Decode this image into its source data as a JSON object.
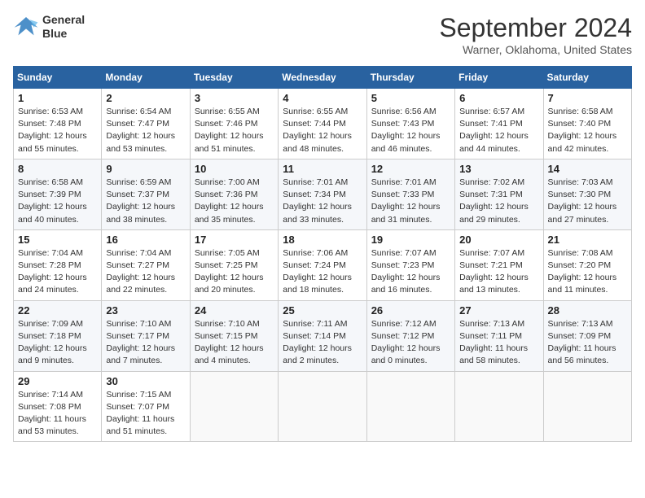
{
  "logo": {
    "line1": "General",
    "line2": "Blue"
  },
  "title": "September 2024",
  "location": "Warner, Oklahoma, United States",
  "days_header": [
    "Sunday",
    "Monday",
    "Tuesday",
    "Wednesday",
    "Thursday",
    "Friday",
    "Saturday"
  ],
  "weeks": [
    [
      {
        "day": "1",
        "info": "Sunrise: 6:53 AM\nSunset: 7:48 PM\nDaylight: 12 hours\nand 55 minutes."
      },
      {
        "day": "2",
        "info": "Sunrise: 6:54 AM\nSunset: 7:47 PM\nDaylight: 12 hours\nand 53 minutes."
      },
      {
        "day": "3",
        "info": "Sunrise: 6:55 AM\nSunset: 7:46 PM\nDaylight: 12 hours\nand 51 minutes."
      },
      {
        "day": "4",
        "info": "Sunrise: 6:55 AM\nSunset: 7:44 PM\nDaylight: 12 hours\nand 48 minutes."
      },
      {
        "day": "5",
        "info": "Sunrise: 6:56 AM\nSunset: 7:43 PM\nDaylight: 12 hours\nand 46 minutes."
      },
      {
        "day": "6",
        "info": "Sunrise: 6:57 AM\nSunset: 7:41 PM\nDaylight: 12 hours\nand 44 minutes."
      },
      {
        "day": "7",
        "info": "Sunrise: 6:58 AM\nSunset: 7:40 PM\nDaylight: 12 hours\nand 42 minutes."
      }
    ],
    [
      {
        "day": "8",
        "info": "Sunrise: 6:58 AM\nSunset: 7:39 PM\nDaylight: 12 hours\nand 40 minutes."
      },
      {
        "day": "9",
        "info": "Sunrise: 6:59 AM\nSunset: 7:37 PM\nDaylight: 12 hours\nand 38 minutes."
      },
      {
        "day": "10",
        "info": "Sunrise: 7:00 AM\nSunset: 7:36 PM\nDaylight: 12 hours\nand 35 minutes."
      },
      {
        "day": "11",
        "info": "Sunrise: 7:01 AM\nSunset: 7:34 PM\nDaylight: 12 hours\nand 33 minutes."
      },
      {
        "day": "12",
        "info": "Sunrise: 7:01 AM\nSunset: 7:33 PM\nDaylight: 12 hours\nand 31 minutes."
      },
      {
        "day": "13",
        "info": "Sunrise: 7:02 AM\nSunset: 7:31 PM\nDaylight: 12 hours\nand 29 minutes."
      },
      {
        "day": "14",
        "info": "Sunrise: 7:03 AM\nSunset: 7:30 PM\nDaylight: 12 hours\nand 27 minutes."
      }
    ],
    [
      {
        "day": "15",
        "info": "Sunrise: 7:04 AM\nSunset: 7:28 PM\nDaylight: 12 hours\nand 24 minutes."
      },
      {
        "day": "16",
        "info": "Sunrise: 7:04 AM\nSunset: 7:27 PM\nDaylight: 12 hours\nand 22 minutes."
      },
      {
        "day": "17",
        "info": "Sunrise: 7:05 AM\nSunset: 7:25 PM\nDaylight: 12 hours\nand 20 minutes."
      },
      {
        "day": "18",
        "info": "Sunrise: 7:06 AM\nSunset: 7:24 PM\nDaylight: 12 hours\nand 18 minutes."
      },
      {
        "day": "19",
        "info": "Sunrise: 7:07 AM\nSunset: 7:23 PM\nDaylight: 12 hours\nand 16 minutes."
      },
      {
        "day": "20",
        "info": "Sunrise: 7:07 AM\nSunset: 7:21 PM\nDaylight: 12 hours\nand 13 minutes."
      },
      {
        "day": "21",
        "info": "Sunrise: 7:08 AM\nSunset: 7:20 PM\nDaylight: 12 hours\nand 11 minutes."
      }
    ],
    [
      {
        "day": "22",
        "info": "Sunrise: 7:09 AM\nSunset: 7:18 PM\nDaylight: 12 hours\nand 9 minutes."
      },
      {
        "day": "23",
        "info": "Sunrise: 7:10 AM\nSunset: 7:17 PM\nDaylight: 12 hours\nand 7 minutes."
      },
      {
        "day": "24",
        "info": "Sunrise: 7:10 AM\nSunset: 7:15 PM\nDaylight: 12 hours\nand 4 minutes."
      },
      {
        "day": "25",
        "info": "Sunrise: 7:11 AM\nSunset: 7:14 PM\nDaylight: 12 hours\nand 2 minutes."
      },
      {
        "day": "26",
        "info": "Sunrise: 7:12 AM\nSunset: 7:12 PM\nDaylight: 12 hours\nand 0 minutes."
      },
      {
        "day": "27",
        "info": "Sunrise: 7:13 AM\nSunset: 7:11 PM\nDaylight: 11 hours\nand 58 minutes."
      },
      {
        "day": "28",
        "info": "Sunrise: 7:13 AM\nSunset: 7:09 PM\nDaylight: 11 hours\nand 56 minutes."
      }
    ],
    [
      {
        "day": "29",
        "info": "Sunrise: 7:14 AM\nSunset: 7:08 PM\nDaylight: 11 hours\nand 53 minutes."
      },
      {
        "day": "30",
        "info": "Sunrise: 7:15 AM\nSunset: 7:07 PM\nDaylight: 11 hours\nand 51 minutes."
      },
      null,
      null,
      null,
      null,
      null
    ]
  ]
}
